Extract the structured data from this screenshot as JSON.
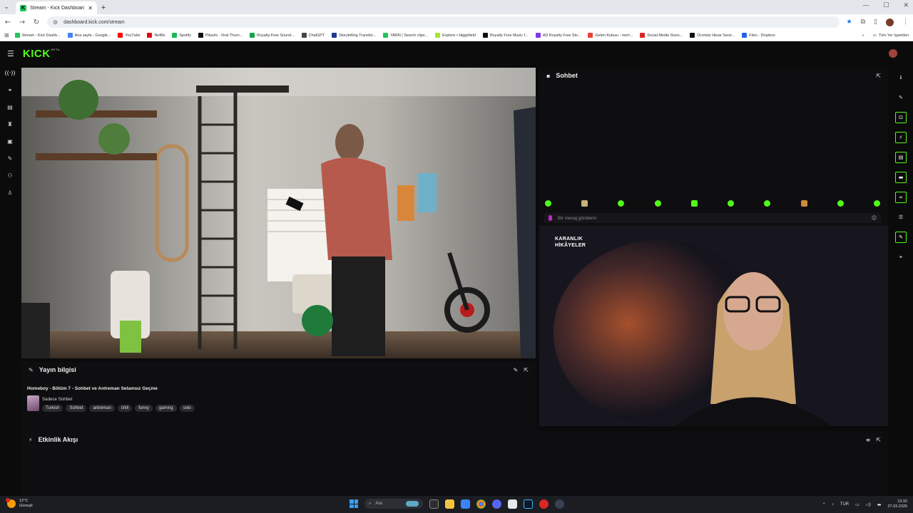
{
  "browser": {
    "tab_title": "Stream - Kick Dashboard",
    "url": "dashboard.kick.com/stream",
    "bookmarks": [
      {
        "label": "Stream - Kick Dashb...",
        "color": "#22c55e"
      },
      {
        "label": "Ana sayfa - Google...",
        "color": "#4285f4"
      },
      {
        "label": "YouTube",
        "color": "#ff0000"
      },
      {
        "label": "Netflix",
        "color": "#e50914"
      },
      {
        "label": "Spotify",
        "color": "#1db954"
      },
      {
        "label": "Pikzels - Viral Thum...",
        "color": "#111111"
      },
      {
        "label": "Royalty-Free Sound...",
        "color": "#16a34a"
      },
      {
        "label": "ChatGPT",
        "color": "#444444"
      },
      {
        "label": "Storytelling Transfor...",
        "color": "#1e3a8a"
      },
      {
        "label": "YARN | Search clips...",
        "color": "#22c55e"
      },
      {
        "label": "Explore • Higgsfield",
        "color": "#a3e635"
      },
      {
        "label": "Royalty Free Music f...",
        "color": "#111111"
      },
      {
        "label": "HD Royalty Free Sto...",
        "color": "#7c3aed"
      },
      {
        "label": "Gelen Kutusu - mert...",
        "color": "#ea4335"
      },
      {
        "label": "Social Media Sizes...",
        "color": "#dc2626"
      },
      {
        "label": "Ücretsiz Hisse Sene...",
        "color": "#111111"
      },
      {
        "label": "Files - Dropbox",
        "color": "#2563eb"
      }
    ],
    "all_bookmarks": "Tüm Yer İşaretleri"
  },
  "kick": {
    "logo": "KICK",
    "logo_badge": "BETA",
    "chat": {
      "title": "Sohbet",
      "input_placeholder": "Bir mesaj gönderin",
      "emote_count": 10
    },
    "overlay_brand": [
      "KARANLIK",
      "HİKÂYELER"
    ],
    "stream_info": {
      "title": "Yayın bilgisi",
      "stream_title": "Homeboy - Bölüm 7 - Sohbet ve Antreman Selamsız Geçme",
      "category": "Sadece Sohbet",
      "tags": [
        "Turkish",
        "Sohbet",
        "antreman",
        "chill",
        "funny",
        "gaming",
        "solo"
      ]
    },
    "activity": {
      "title": "Etkinlik Akışı"
    }
  },
  "taskbar": {
    "weather_temp": "12°C",
    "weather_text": "Güneşli",
    "search_placeholder": "Ara",
    "lang": "TUR",
    "time": "13:32",
    "date": "27.03.2026"
  },
  "colors": {
    "kick_green": "#53fc18",
    "bg": "#0b0b0c",
    "panel": "#0e0e10"
  }
}
